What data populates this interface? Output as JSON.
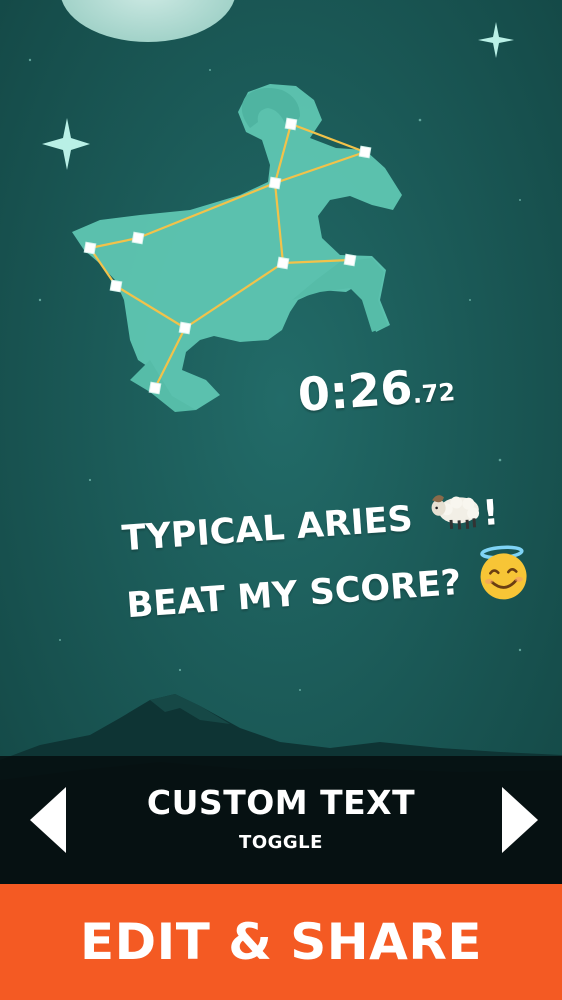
{
  "score": {
    "time_main": "0:26",
    "time_fraction": ".72"
  },
  "share_message": {
    "line1": "TYPICAL ARIES",
    "line1_end": "!",
    "line1_emoji": "ram-icon",
    "line2": "BEAT MY SCORE?",
    "line2_emoji": "smiling-face-with-halo-icon"
  },
  "text_toggle": {
    "title": "CUSTOM TEXT",
    "subtitle": "TOGGLE",
    "prev_icon": "arrow-left-icon",
    "next_icon": "arrow-right-icon"
  },
  "cta": {
    "label": "EDIT & SHARE",
    "color": "#f45a23"
  },
  "constellation": {
    "name_icon": "aries-ram-constellation",
    "line_color": "#f2c24a",
    "figure_color": "#5fc6b2"
  },
  "colors": {
    "sky": "#1a5a58",
    "bar": "#0a1517"
  }
}
